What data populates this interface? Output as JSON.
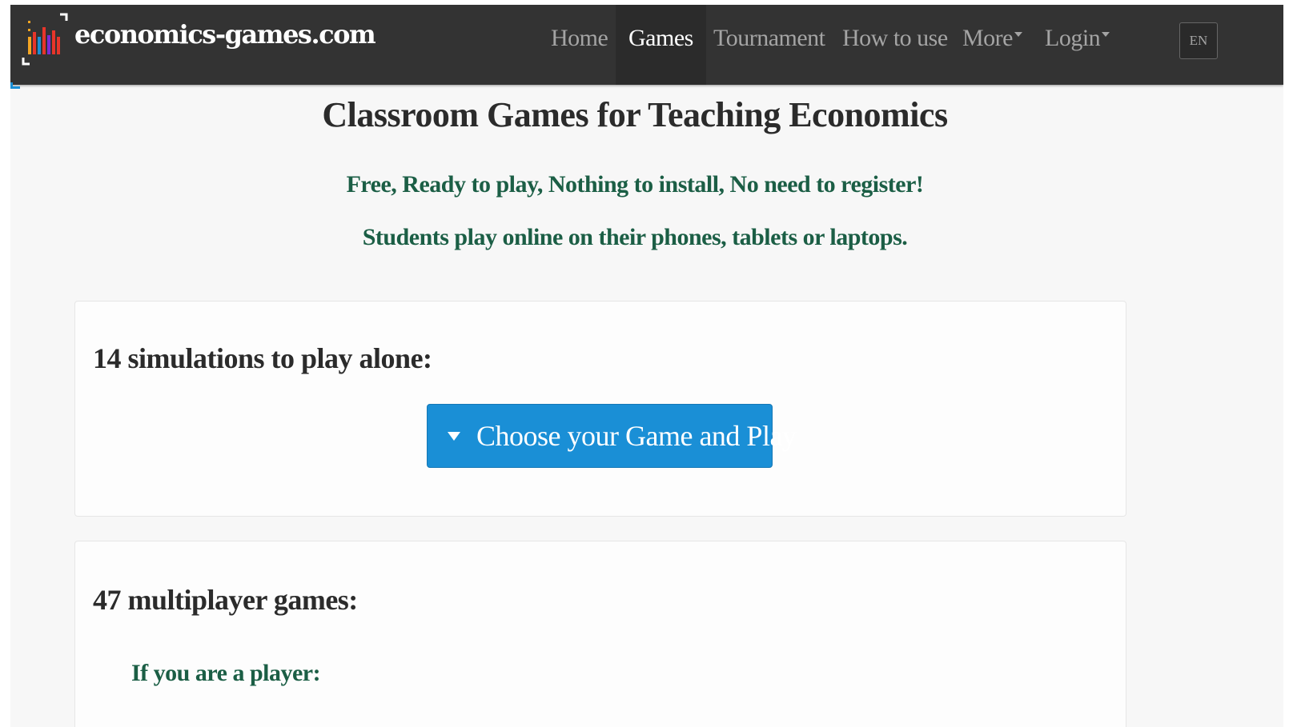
{
  "navbar": {
    "brand": "economics-games.com",
    "items": [
      {
        "label": "Home"
      },
      {
        "label": "Games",
        "active": true
      },
      {
        "label": "Tournament"
      },
      {
        "label": "How to use"
      },
      {
        "label": "More",
        "dropdown": true
      },
      {
        "label": "Login",
        "dropdown": true
      }
    ],
    "language": "EN"
  },
  "main": {
    "title": "Classroom Games for Teaching Economics",
    "taglines": [
      "Free, Ready to play, Nothing to install, No need to register!",
      "Students play online on their phones, tablets or laptops."
    ],
    "solo_panel": {
      "heading": "14 simulations to play alone:",
      "button_label": "Choose your Game and Play"
    },
    "multi_panel": {
      "heading": "47 multiplayer games:",
      "player_label": "If you are a player:"
    }
  },
  "colors": {
    "navbar_bg": "#333333",
    "accent_button": "#1a8fd6",
    "tagline_green": "#1b5e45",
    "logo_bars": [
      "#e8352a",
      "#f5a623",
      "#1a8fd6",
      "#e8352a",
      "#7a2bd6",
      "#e8352a"
    ]
  },
  "icons": [
    "logo-icon",
    "caret-down-icon",
    "scroll-up-icon"
  ]
}
